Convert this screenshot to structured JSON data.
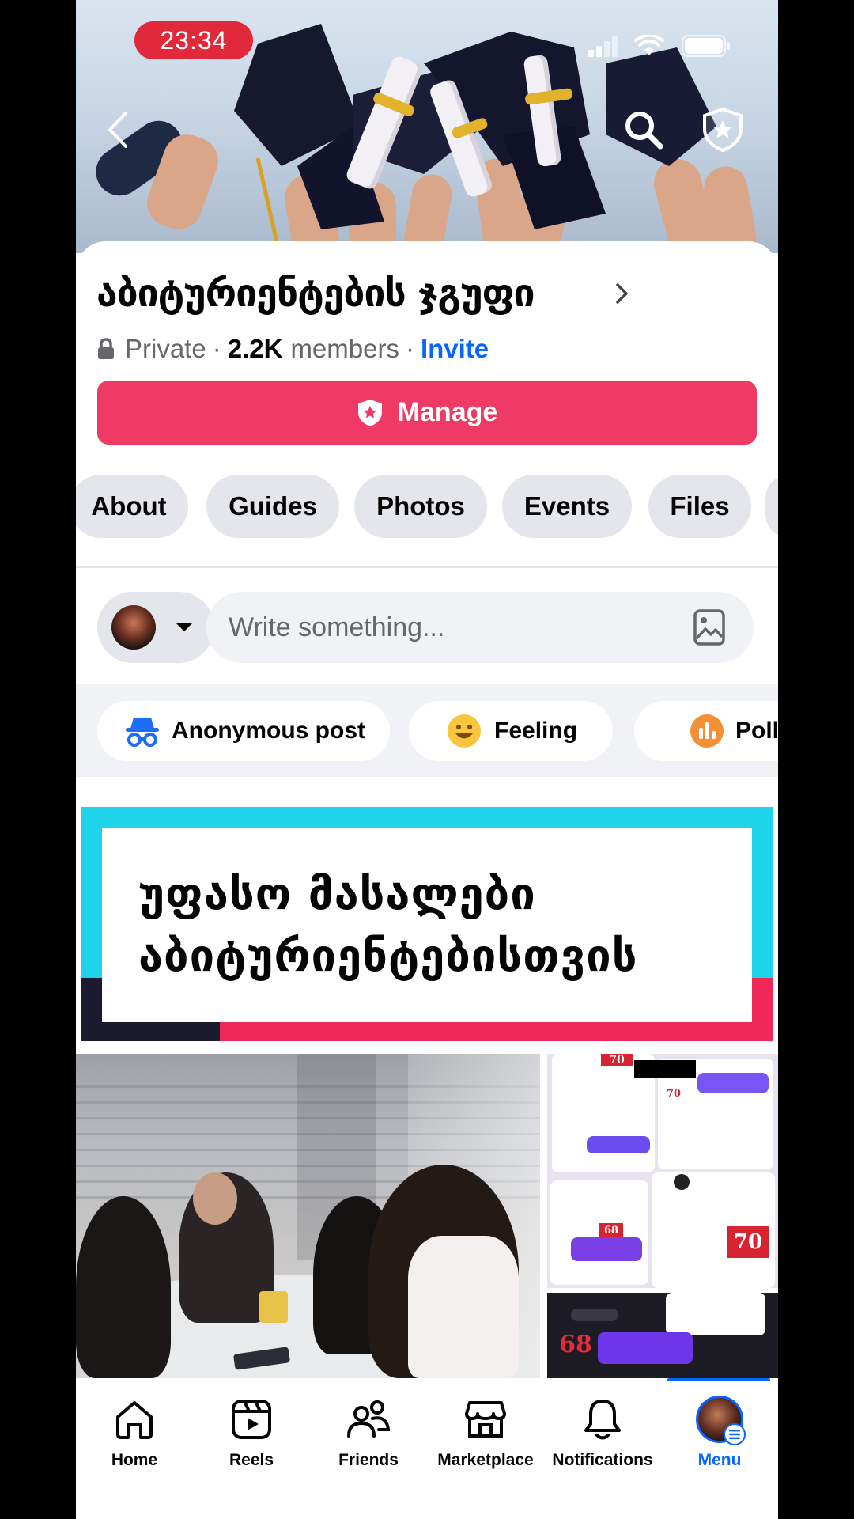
{
  "status_bar": {
    "time": "23:34"
  },
  "colors": {
    "brand": "#0866ff",
    "manage": "#ee3a64",
    "status_pill": "#e2283b"
  },
  "group": {
    "title": "აბიტურიენტების ჯგუფი",
    "privacy": "Private",
    "member_count": "2.2K",
    "members_label": "members",
    "invite": "Invite",
    "manage_label": "Manage"
  },
  "tabs": [
    "About",
    "Guides",
    "Photos",
    "Events",
    "Files"
  ],
  "composer": {
    "placeholder": "Write something..."
  },
  "chips": [
    "Anonymous post",
    "Feeling",
    "Poll"
  ],
  "post": {
    "banner_line1": "უფასო მასალები",
    "banner_line2": "აბიტურიენტებისთვის",
    "screenshot_badges": [
      "70",
      "70",
      "68",
      "70",
      "68"
    ]
  },
  "nav": {
    "home": "Home",
    "reels": "Reels",
    "friends": "Friends",
    "marketplace": "Marketplace",
    "notifications": "Notifications",
    "menu": "Menu"
  },
  "icons": [
    "back-icon",
    "search-icon",
    "admin-shield-icon",
    "lock-icon",
    "chevron-right-icon",
    "shield-star-icon",
    "caret-down-icon",
    "photo-icon",
    "incognito-icon",
    "smile-icon",
    "poll-icon",
    "home-icon",
    "reels-icon",
    "friends-icon",
    "marketplace-icon",
    "bell-icon",
    "menu-icon"
  ]
}
